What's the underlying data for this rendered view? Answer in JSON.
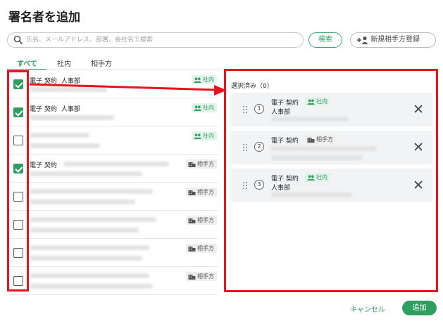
{
  "dialog": {
    "title": "署名者を追加"
  },
  "search": {
    "placeholder": "氏名、メールアドレス、部署、会社名で検索",
    "button_label": "検索",
    "new_partner_label": "新規相手方登録"
  },
  "tabs": [
    {
      "label": "すべて",
      "active": true
    },
    {
      "label": "社内"
    },
    {
      "label": "相手方"
    }
  ],
  "badges": {
    "internal": "社内",
    "external": "相手方"
  },
  "rows": [
    {
      "checked": true,
      "name": "電子 契約",
      "dept": "人事部",
      "type": "internal"
    },
    {
      "checked": true,
      "name": "電子 契約",
      "dept": "人事部",
      "type": "internal"
    },
    {
      "checked": false,
      "name": "",
      "dept": "",
      "type": "internal"
    },
    {
      "checked": true,
      "name": "電子 契約",
      "dept": "",
      "type": "external"
    },
    {
      "checked": false,
      "name": "",
      "dept": "",
      "type": "external"
    },
    {
      "checked": false,
      "name": "",
      "dept": "",
      "type": "external"
    },
    {
      "checked": false,
      "name": "",
      "dept": "",
      "type": "external"
    },
    {
      "checked": false,
      "name": "",
      "dept": "",
      "type": "external"
    }
  ],
  "selected": {
    "title": "選択済み（0）",
    "items": [
      {
        "num": "1",
        "name": "電子 契約",
        "dept": "人事部",
        "type": "internal"
      },
      {
        "num": "2",
        "name": "電子 契約",
        "dept": "",
        "type": "external"
      },
      {
        "num": "3",
        "name": "電子 契約",
        "dept": "人事部",
        "type": "internal"
      }
    ]
  },
  "footer": {
    "cancel_label": "キャンセル",
    "add_label": "追加"
  },
  "colors": {
    "accent": "#2f9e61",
    "highlight": "#e8131d"
  }
}
